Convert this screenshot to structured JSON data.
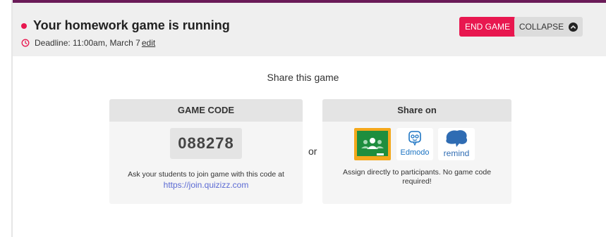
{
  "header": {
    "title": "Your homework game is running",
    "deadline_text": "Deadline: 11:00am, March 7",
    "edit_label": "edit",
    "end_game_label": "END GAME",
    "collapse_label": "COLLAPSE"
  },
  "share": {
    "title": "Share this game",
    "or_label": "or",
    "game_code_card": {
      "heading": "GAME CODE",
      "code": "088278",
      "instruction": "Ask your students to join game with this code at",
      "url": "https://join.quizizz.com"
    },
    "share_on_card": {
      "heading": "Share on",
      "platforms": [
        {
          "name": "Google Classroom",
          "icon": "google-classroom-icon"
        },
        {
          "name": "Edmodo",
          "label": "Edmodo",
          "icon": "edmodo-icon"
        },
        {
          "name": "Remind",
          "label": "remind",
          "icon": "remind-icon"
        }
      ],
      "note": "Assign directly to participants. No game code required!"
    }
  },
  "colors": {
    "accent": "#e8174f",
    "top_border": "#6a1b58",
    "link": "#5b6ad3",
    "google_classroom_yellow": "#f4a81b",
    "google_classroom_green": "#1e8e3e",
    "edmodo_blue": "#1c74c3",
    "remind_blue": "#2f6cb3"
  }
}
